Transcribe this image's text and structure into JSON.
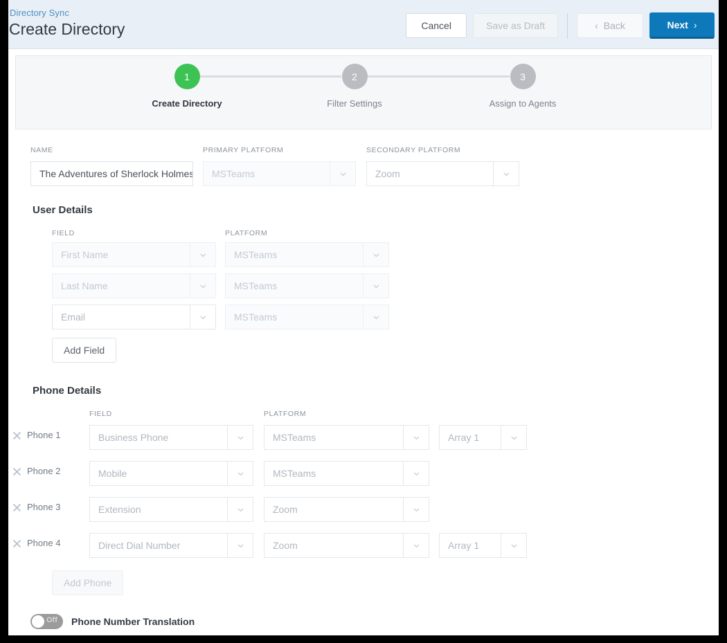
{
  "header": {
    "breadcrumb": "Directory Sync",
    "title": "Create Directory",
    "cancel_label": "Cancel",
    "save_draft_label": "Save as Draft",
    "back_label": "Back",
    "next_label": "Next",
    "back_chevron": "‹",
    "next_chevron": "›"
  },
  "colors": {
    "accent_blue": "#0d79ba",
    "step_active_green": "#3cc354",
    "step_idle_gray": "#b9bcc0",
    "header_bg": "#e9eff6",
    "breadcrumb_link": "#4a90c4"
  },
  "stepper": {
    "steps": [
      {
        "number": "1",
        "label": "Create Directory",
        "state": "active"
      },
      {
        "number": "2",
        "label": "Filter Settings",
        "state": "idle"
      },
      {
        "number": "3",
        "label": "Assign to Agents",
        "state": "idle"
      }
    ]
  },
  "top_fields": {
    "name": {
      "label": "NAME",
      "value": "The Adventures of Sherlock Holmes",
      "placeholder": "Name"
    },
    "primary_platform": {
      "label": "PRIMARY PLATFORM",
      "value": "MSTeams"
    },
    "secondary_platform": {
      "label": "SECONDARY PLATFORM",
      "value": "Zoom"
    }
  },
  "user_details": {
    "title": "User Details",
    "col_field": "FIELD",
    "col_platform": "PLATFORM",
    "rows": [
      {
        "field": "First Name",
        "platform": "MSTeams",
        "field_disabled": true,
        "platform_disabled": true
      },
      {
        "field": "Last Name",
        "platform": "MSTeams",
        "field_disabled": true,
        "platform_disabled": true
      },
      {
        "field": "Email",
        "platform": "MSTeams",
        "field_disabled": false,
        "platform_disabled": true
      }
    ],
    "add_field_label": "Add Field"
  },
  "phone_details": {
    "title": "Phone Details",
    "col_field": "FIELD",
    "col_platform": "PLATFORM",
    "rows": [
      {
        "name": "Phone 1",
        "field": "Business Phone",
        "platform": "MSTeams",
        "array": "Array 1"
      },
      {
        "name": "Phone 2",
        "field": "Mobile",
        "platform": "MSTeams",
        "array": null
      },
      {
        "name": "Phone 3",
        "field": "Extension",
        "platform": "Zoom",
        "array": null
      },
      {
        "name": "Phone 4",
        "field": "Direct Dial Number",
        "platform": "Zoom",
        "array": "Array 1"
      }
    ],
    "add_phone_label": "Add Phone"
  },
  "translation_toggle": {
    "state_label": "Off",
    "label": "Phone Number Translation"
  }
}
